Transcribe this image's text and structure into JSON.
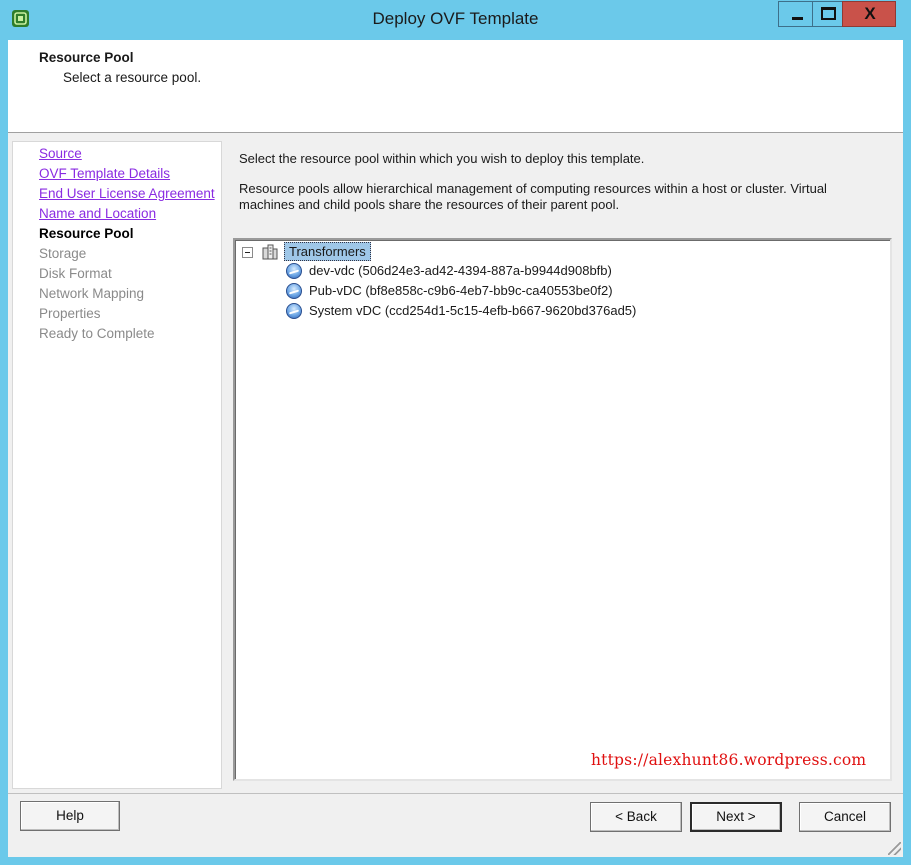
{
  "window": {
    "title": "Deploy OVF Template",
    "controls": {
      "minimize": "minimize-icon",
      "maximize": "maximize-icon",
      "close": "close-icon",
      "close_glyph": "X"
    }
  },
  "header": {
    "title": "Resource Pool",
    "subtitle": "Select a resource pool."
  },
  "nav": {
    "items": [
      {
        "label": "Source",
        "state": "link"
      },
      {
        "label": "OVF Template Details",
        "state": "link"
      },
      {
        "label": "End User License Agreement",
        "state": "link"
      },
      {
        "label": "Name and Location",
        "state": "link"
      },
      {
        "label": "Resource Pool",
        "state": "current"
      },
      {
        "label": "Storage",
        "state": "disabled"
      },
      {
        "label": "Disk Format",
        "state": "disabled"
      },
      {
        "label": "Network Mapping",
        "state": "disabled"
      },
      {
        "label": "Properties",
        "state": "disabled"
      },
      {
        "label": "Ready to Complete",
        "state": "disabled"
      }
    ]
  },
  "content": {
    "intro": "Select the resource pool within which you wish to deploy this template.",
    "description": "Resource pools allow hierarchical management of computing resources within a host or cluster. Virtual machines and child pools share the resources of their parent pool."
  },
  "tree": {
    "root": {
      "label": "Transformers",
      "icon": "cluster-icon",
      "expanded": true,
      "selected": true
    },
    "children": [
      {
        "label": "dev-vdc (506d24e3-ad42-4394-887a-b9944d908bfb)",
        "icon": "resource-pool-icon"
      },
      {
        "label": "Pub-vDC (bf8e858c-c9b6-4eb7-bb9c-ca40553be0f2)",
        "icon": "resource-pool-icon"
      },
      {
        "label": "System vDC (ccd254d1-5c15-4efb-b667-9620bd376ad5)",
        "icon": "resource-pool-icon"
      }
    ]
  },
  "watermark": "https://alexhunt86.wordpress.com",
  "buttons": {
    "help": "Help",
    "back": "< Back",
    "next": "Next >",
    "cancel": "Cancel"
  },
  "colors": {
    "title_bar": "#6bc9ea",
    "close_button": "#c9524a",
    "link": "#8a2be2",
    "selection": "#9fc7e8",
    "watermark": "#e01010"
  }
}
